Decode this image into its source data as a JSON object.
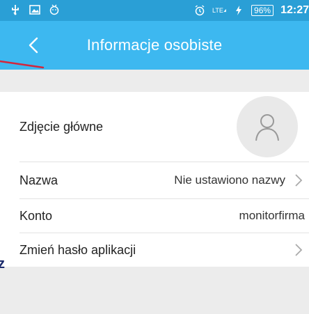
{
  "status_bar": {
    "battery": "96%",
    "lte": "LTE",
    "time": "12:27",
    "icons": [
      "usb-icon",
      "image-icon",
      "face-icon",
      "alarm-icon",
      "signal-icon",
      "charging-icon",
      "battery-icon"
    ]
  },
  "header": {
    "title": "Informacje osobiste",
    "back_icon": "chevron-left-icon",
    "color": "#3db8f0"
  },
  "rows": [
    {
      "label": "Zdjęcie główne"
    },
    {
      "label": "Nazwa",
      "value": "Nie ustawiono nazwy"
    },
    {
      "label": "Konto",
      "value": "monitorfirma"
    },
    {
      "label": "Zmień hasło aplikacji"
    }
  ],
  "annotation": {
    "letter": "z",
    "line_color": "#d4263c"
  }
}
